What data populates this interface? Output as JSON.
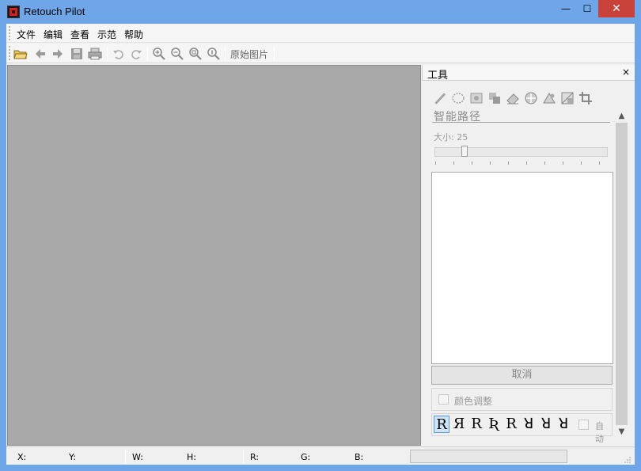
{
  "window": {
    "title": "Retouch Pilot",
    "minimize_label": "—",
    "maximize_label": "☐",
    "close_label": "✕"
  },
  "menu": {
    "items": [
      "文件",
      "编辑",
      "查看",
      "示范",
      "帮助"
    ]
  },
  "toolbar": {
    "original_image_label": "原始图片",
    "buttons": [
      "open-icon",
      "back-arrow-icon",
      "forward-arrow-icon",
      "save-icon",
      "print-icon",
      "undo-icon",
      "redo-icon",
      "zoom-in-icon",
      "zoom-out-icon",
      "zoom-fit-icon",
      "zoom-actual-icon"
    ]
  },
  "tools_panel": {
    "title": "工具",
    "close_label": "×",
    "tool_icons": [
      "pencil-icon",
      "lasso-icon",
      "stamp-icon",
      "patch-icon",
      "eraser-icon",
      "target-icon",
      "triangle-ruler-icon",
      "layer-icon",
      "crop-icon"
    ],
    "tool_name": "智能路径",
    "size_label": "大小: 25",
    "size_value": 25,
    "cancel_label": "取消",
    "color_adjust_label": "颜色调整",
    "glyphs": [
      "R",
      "Я",
      "R",
      "Ʀ",
      "R",
      "ꓤ",
      "ꓤ",
      "ꓤ"
    ],
    "auto_label": "自动"
  },
  "status": {
    "x_label": "X:",
    "y_label": "Y:",
    "w_label": "W:",
    "h_label": "H:",
    "r_label": "R:",
    "g_label": "G:",
    "b_label": "B:"
  },
  "colors": {
    "title_bar": "#6ea6e8",
    "close_button": "#c9423a",
    "canvas": "#a9a9a9",
    "panel_bg": "#f0f0f0"
  }
}
